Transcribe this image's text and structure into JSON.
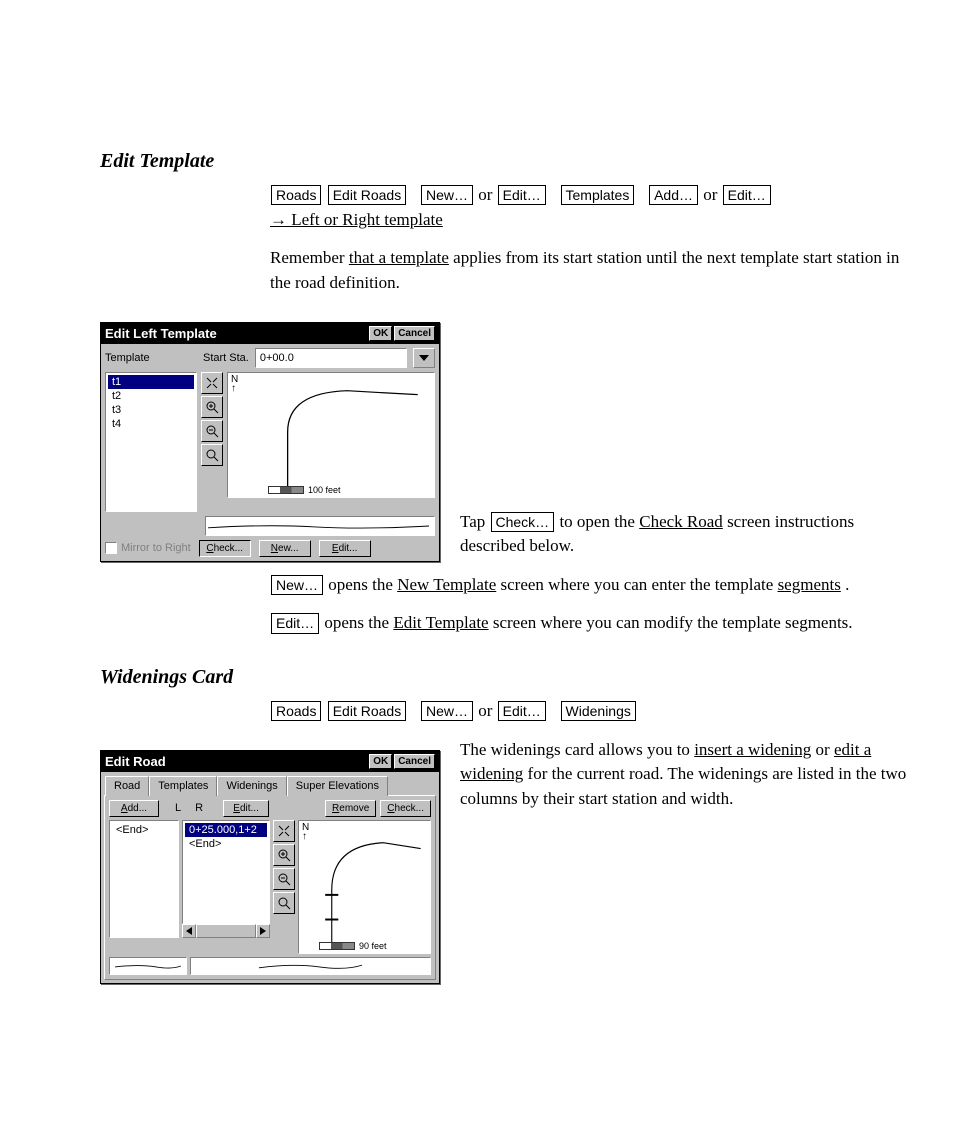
{
  "section1": {
    "heading": "Edit Template",
    "para1_pre": "",
    "btn_roads": "Roads",
    "btn_editroads": "Edit Roads",
    "btn_new1": "New…",
    "or1": " or ",
    "btn_edit1": "Edit…",
    "btn_templates": "Templates",
    "btn_add": "Add…",
    "or2": " or ",
    "btn_edit2": "Edit…",
    "arrow_link": " → Left or Right template",
    "reminder_pre": "Remember ",
    "reminder_link": "that a template",
    "reminder_post": " applies from its start station until the next template start station in the road definition.",
    "check_pre1": "Tap ",
    "check_btn": "Check…",
    "check_mid": " to open the ",
    "check_link": "Check Road",
    "check_post": " screen instructions described below.",
    "new_pre": "",
    "btn_new2": "New…",
    "new_mid": " opens the ",
    "new_link": "New Template",
    "new_post1": " screen where you can enter the template ",
    "new_link2": "segments",
    "new_post2": ".",
    "edit_pre": "",
    "btn_edit3": "Edit…",
    "edit_mid": " opens the ",
    "edit_link": "Edit Template",
    "edit_post": " screen where you can modify the template segments."
  },
  "dialog1": {
    "title": "Edit Left Template",
    "ok": "OK",
    "cancel": "Cancel",
    "label_template": "Template",
    "label_startsta": "Start Sta.",
    "startsta_value": "0+00.0",
    "items": [
      "t1",
      "t2",
      "t3",
      "t4"
    ],
    "mirror": "Mirror to Right",
    "btn_check": "Check...",
    "btn_new": "New...",
    "btn_edit": "Edit...",
    "scale": "100 feet"
  },
  "section2": {
    "heading": "Widenings Card",
    "btn_roads": "Roads",
    "btn_editroads": "Edit Roads",
    "btn_new": "New…",
    "or1": " or ",
    "btn_edit": "Edit…",
    "btn_widenings": "Widenings",
    "para2_pre": "The widenings card allows you to ",
    "para2_link1": "insert a widening",
    "para2_mid": " or ",
    "para2_link2": "edit a widening",
    "para2_mid2": " for the ",
    "para2_link3": "",
    "para2_post": "current road. The widenings are listed in the two columns by their start station and width."
  },
  "dialog2": {
    "title": "Edit Road",
    "ok": "OK",
    "cancel": "Cancel",
    "tabs": [
      "Road",
      "Templates",
      "Widenings",
      "Super Elevations"
    ],
    "btn_add": "Add...",
    "l": "L",
    "r": "R",
    "btn_edit": "Edit...",
    "btn_remove": "Remove",
    "btn_check": "Check...",
    "left_item": "<End>",
    "right_item_sel": "0+25.000,1+2",
    "right_item_end": "<End>",
    "scale": "90 feet"
  }
}
